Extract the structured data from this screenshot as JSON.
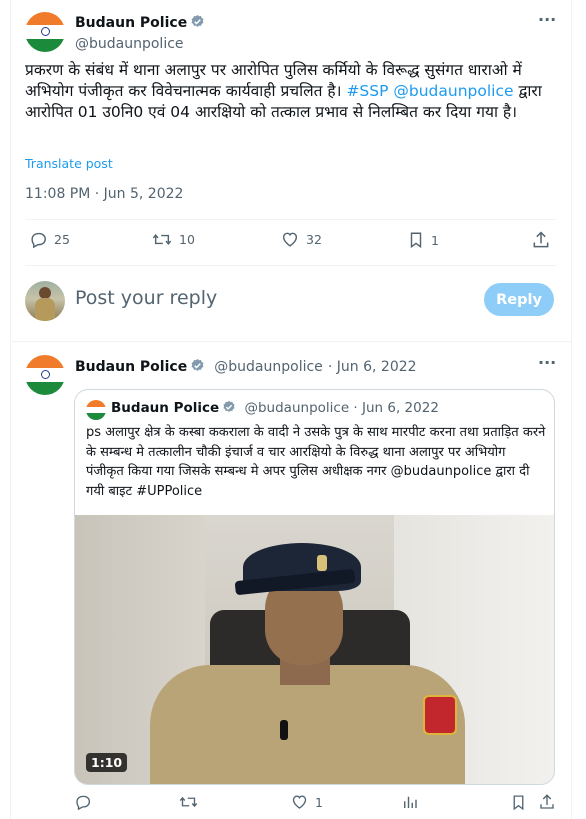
{
  "tweet": {
    "author_name": "Budaun Police",
    "author_handle": "@budaunpolice",
    "more_label": "···",
    "text_part1": "प्रकरण के संबंध में थाना अलापुर पर आरोपित पुलिस कर्मियो के विरूद्ध सुसंगत धाराओ में अभियोग पंजीकृत कर विवेचनात्मक कार्यवाही प्रचलित है। ",
    "hashtag": "#SSP",
    "mention": "@budaunpolice",
    "text_part2": " द्वारा आरोपित 01 उ0नि0 एवं 04 आरक्षियो को तत्काल प्रभाव से निलम्बित कर दिया गया है।",
    "translate_label": "Translate post",
    "timestamp": "11:08 PM · Jun 5, 2022",
    "stats": {
      "replies": "25",
      "reposts": "10",
      "likes": "32",
      "bookmarks": "1"
    }
  },
  "reply_box": {
    "placeholder": "Post your reply",
    "button_label": "Reply"
  },
  "reply_tweet": {
    "author_name": "Budaun Police",
    "author_handle": "@budaunpolice",
    "date": "· Jun 6, 2022",
    "more_label": "···",
    "quote": {
      "author_name": "Budaun Police",
      "author_handle": "@budaunpolice",
      "date": "· Jun 6, 2022",
      "text": "ps अलापुर क्षेत्र के कस्बा ककराला के वादी ने उसके पुत्र के साथ मारपीट करना तथा प्रताड़ित करने के सम्बन्ध मे तत्कालीन चौकी इंचार्ज व चार आरक्षियो के विरुद्ध थाना अलापुर पर अभियोग पंजीकृत किया गया जिसके सम्बन्ध मे अपर पुलिस अधीक्षक नगर @budaunpolice द्वारा दी गयी बाइट #UPPolice",
      "video_duration": "1:10"
    },
    "stats": {
      "likes": "1"
    }
  },
  "colors": {
    "accent": "#1d9bf0",
    "muted": "#536471",
    "verified": "#829aab"
  }
}
